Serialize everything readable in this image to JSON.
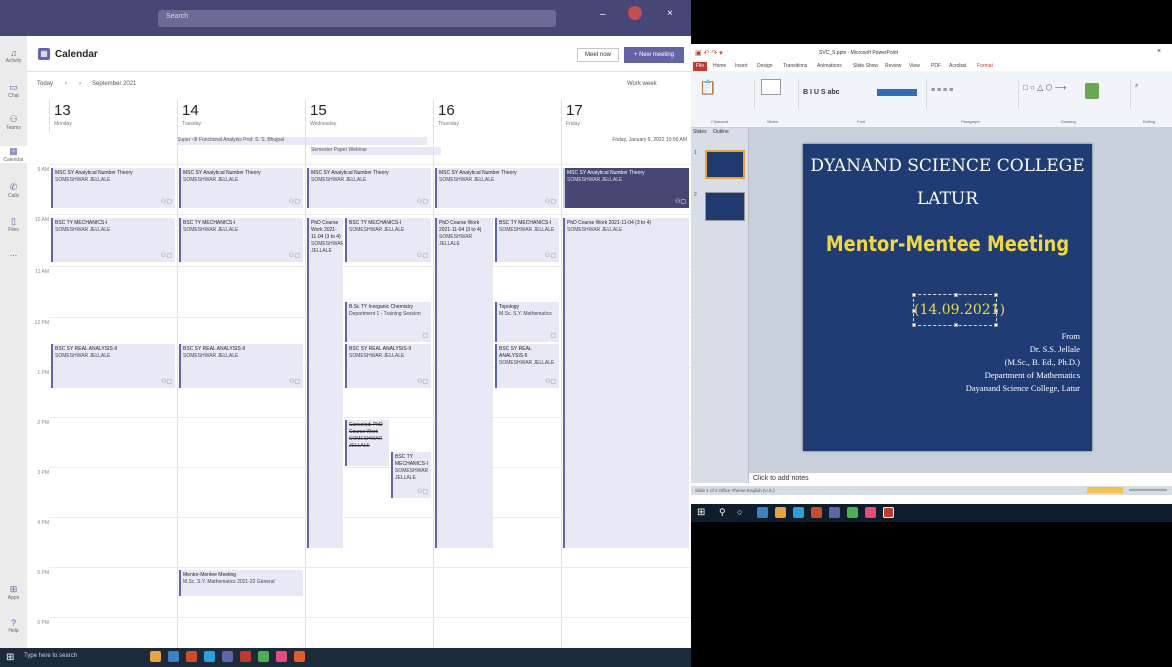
{
  "teams": {
    "search_placeholder": "Search",
    "rail": [
      "Activity",
      "Chat",
      "Teams",
      "Calendar",
      "Calls",
      "Files",
      "...",
      "Apps",
      "Help"
    ],
    "calendar_title": "Calendar",
    "meet_now": "Meet now",
    "new_meeting": "+ New meeting",
    "today": "Today",
    "month": "September 2021",
    "view": "Work week",
    "days": [
      {
        "num": "13",
        "name": "Monday"
      },
      {
        "num": "14",
        "name": "Tuesday"
      },
      {
        "num": "15",
        "name": "Wednesday"
      },
      {
        "num": "16",
        "name": "Thursday"
      },
      {
        "num": "17",
        "name": "Friday"
      }
    ],
    "allday_1": "Super -III Functional Analysis Prof. S. S. Bhujpal",
    "allday_2": "Semester Paper Webinar",
    "allday_right": "Friday, January 9, 2022 10:00 AM",
    "times": [
      "9 AM",
      "10 AM",
      "11 AM",
      "12 PM",
      "1 PM",
      "2 PM",
      "3 PM",
      "4 PM",
      "5 PM",
      "6 PM"
    ],
    "events": {
      "e1": {
        "t": "MSC SY Analytical Number Theory",
        "s": "SOMESHWAR JELLALE"
      },
      "e2": {
        "t": "MSC SY Analytical Number Theory",
        "s": "SOMESHWAR JELLALE"
      },
      "e3": {
        "t": "MSC SY Analytical Number Theory",
        "s": "SOMESHWAR JELLALE"
      },
      "e4": {
        "t": "MSC SY Analytical Number Theory",
        "s": "SOMESHWAR JELLALE"
      },
      "e5": {
        "t": "MSC SY Analytical Number Theory",
        "s": "SOMESHWAR JELLALE"
      },
      "e6": {
        "t": "BSC TY MECHANICS-I",
        "s": "SOMESHWAR JELLALE"
      },
      "e7": {
        "t": "BSC TY MECHANICS-I",
        "s": "SOMESHWAR JELLALE"
      },
      "e8": {
        "t": "PhD Course Work 2021-11-04 (3 to 4)",
        "s": "SOMESHWAR JELLALE"
      },
      "e9": {
        "t": "BSC TY MECHANICS-I",
        "s": "SOMESHWAR JELLALE"
      },
      "e10": {
        "t": "PhD Course Work 2021-11-04 (3 to 4)",
        "s": "SOMESHWAR JELLALE"
      },
      "e11": {
        "t": "BSC TY MECHANICS-I",
        "s": "SOMESHWAR JELLALE"
      },
      "e12": {
        "t": "PhD Course Work 2021-11-04 (3 to 4)",
        "s": "SOMESHWAR JELLALE"
      },
      "e13": {
        "t": "B.Sc TY Inorganic Chemistry",
        "s": "Department 1 - Training Session"
      },
      "e14": {
        "t": "Topology",
        "s": "M.Sc. S.Y. Mathematics"
      },
      "e15": {
        "t": "BSC SY REAL ANALYSIS-II",
        "s": "SOMESHWAR JELLALE"
      },
      "e16": {
        "t": "BSC SY REAL ANALYSIS-II",
        "s": "SOMESHWAR JELLALE"
      },
      "e17": {
        "t": "BSC SY REAL ANALYSIS-II",
        "s": "SOMESHWAR JELLALE"
      },
      "e18": {
        "t": "BSC SY REAL ANALYSIS-II",
        "s": "SOMESHWAR JELLALE"
      },
      "e19": {
        "t": "Canceled: PhD Course Work",
        "s": "SOMESHWAR JELLALE"
      },
      "e20": {
        "t": "BSC TY MECHANICS-I",
        "s": "SOMESHWAR JELLALE"
      },
      "e21": {
        "t": "Mentor-Mentee Meeting",
        "s": "M.Sc. S.Y. Mathematics 2021-22 General"
      }
    },
    "task_search": "Type here to search"
  },
  "ppt": {
    "title": "SVC_S.pptx - Microsoft PowerPoint",
    "file_tab": "File",
    "tabs": [
      "Home",
      "Insert",
      "Design",
      "Transitions",
      "Animations",
      "Slide Show",
      "Review",
      "View",
      "PDF",
      "Acrobat",
      "Format"
    ],
    "groups": [
      "Clipboard",
      "Slides",
      "Font",
      "Paragraph",
      "Drawing",
      "Editing"
    ],
    "slide_tab": "Slides",
    "outline_tab": "Outline",
    "slide": {
      "college": "DYANAND SCIENCE COLLEGE",
      "city": "LATUR",
      "meeting": "Mentor-Mentee Meeting",
      "date": "(14.09.2021)",
      "from": "From",
      "name": "Dr. S.S. Jellale",
      "degrees": "(M.Sc., B. Ed., Ph.D.)",
      "dept": "Department of Mathematics",
      "college_full": "Dayanand Science College, Latur"
    },
    "notes": "Click to add notes",
    "status": "Slide 1 of 2    Office Theme    English (U.S.)"
  },
  "colors": {
    "teams_purple": "#6264a7",
    "slide_bg": "#1f3c74",
    "slide_yellow": "#f1d93b"
  }
}
